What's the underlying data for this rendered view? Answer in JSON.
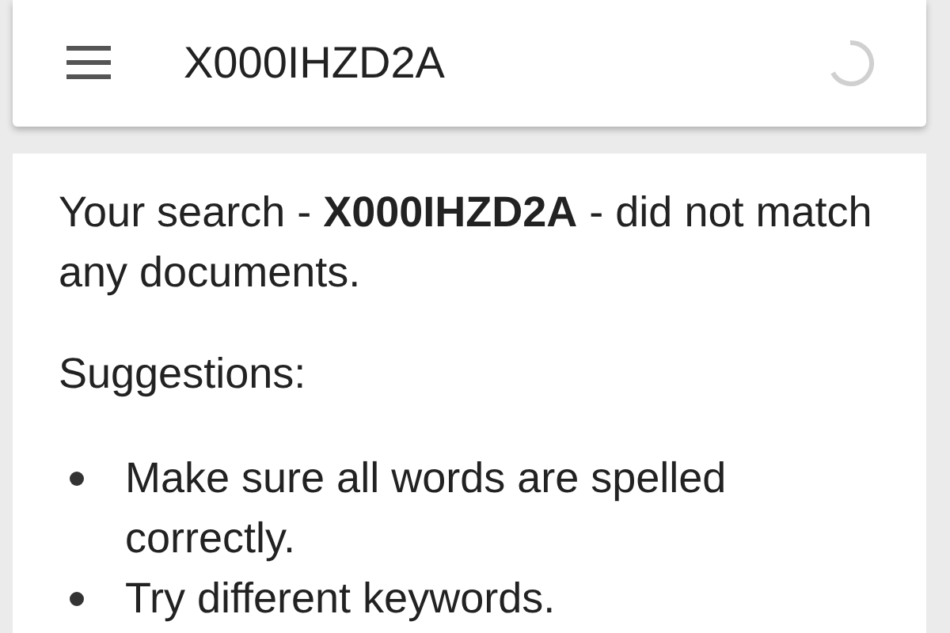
{
  "toolbar": {
    "query": "X000IHZD2A"
  },
  "result": {
    "message": "Your search - **X000IHZD2A** - did not match any documents.",
    "suggestions_heading": "Suggestions:",
    "suggestions": [
      "Make sure all words are spelled correctly.",
      "Try different keywords."
    ]
  }
}
